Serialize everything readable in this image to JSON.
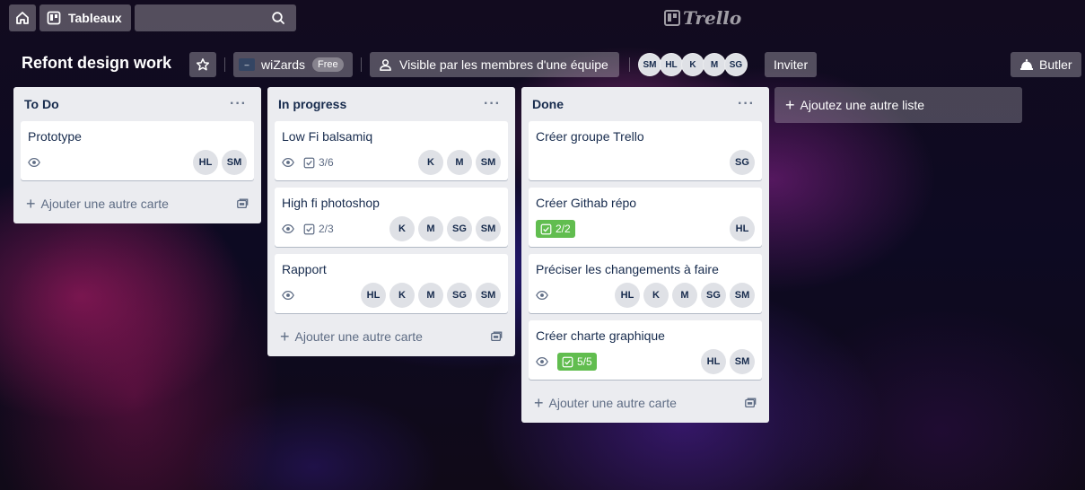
{
  "topbar": {
    "home_icon": "home-icon",
    "boards_label": "Tableaux",
    "search_icon": "search-icon",
    "logo_text": "Trello"
  },
  "board": {
    "title": "Refont design work",
    "team_name": "wiZards",
    "team_badge": "Free",
    "visibility_label": "Visible par les membres d'une équipe",
    "members": [
      "SM",
      "HL",
      "K",
      "M",
      "SG"
    ],
    "invite_label": "Inviter",
    "butler_label": "Butler"
  },
  "lists": [
    {
      "title": "To Do",
      "menu": "···",
      "add_card_label": "Ajouter une autre carte",
      "cards": [
        {
          "title": "Prototype",
          "watch": true,
          "checklist": "",
          "members": [
            "HL",
            "SM"
          ]
        }
      ]
    },
    {
      "title": "In progress",
      "menu": "···",
      "add_card_label": "Ajouter une autre carte",
      "cards": [
        {
          "title": "Low Fi balsamiq",
          "watch": true,
          "checklist": "3/6",
          "members": [
            "K",
            "M",
            "SM"
          ]
        },
        {
          "title": "High fi photoshop",
          "watch": true,
          "checklist": "2/3",
          "members": [
            "K",
            "M",
            "SG",
            "SM"
          ]
        },
        {
          "title": "Rapport",
          "watch": true,
          "checklist": "",
          "members": [
            "HL",
            "K",
            "M",
            "SG",
            "SM"
          ]
        }
      ]
    },
    {
      "title": "Done",
      "menu": "···",
      "add_card_label": "Ajouter une autre carte",
      "cards": [
        {
          "title": "Créer groupe Trello",
          "watch": false,
          "checklist": "",
          "members": [
            "SG"
          ]
        },
        {
          "title": "Créer Githab répo",
          "watch": false,
          "checklist_done": "2/2",
          "members": [
            "HL"
          ]
        },
        {
          "title": "Préciser les changements à faire",
          "watch": true,
          "checklist": "",
          "members": [
            "HL",
            "K",
            "M",
            "SG",
            "SM"
          ]
        },
        {
          "title": "Créer charte graphique",
          "watch": true,
          "checklist_done": "5/5",
          "members": [
            "HL",
            "SM"
          ]
        }
      ]
    }
  ],
  "add_list_label": "Ajoutez une autre liste",
  "colors": {
    "list_bg": "#ebecf0",
    "done_badge": "#61bd4f",
    "text": "#172b4d"
  }
}
